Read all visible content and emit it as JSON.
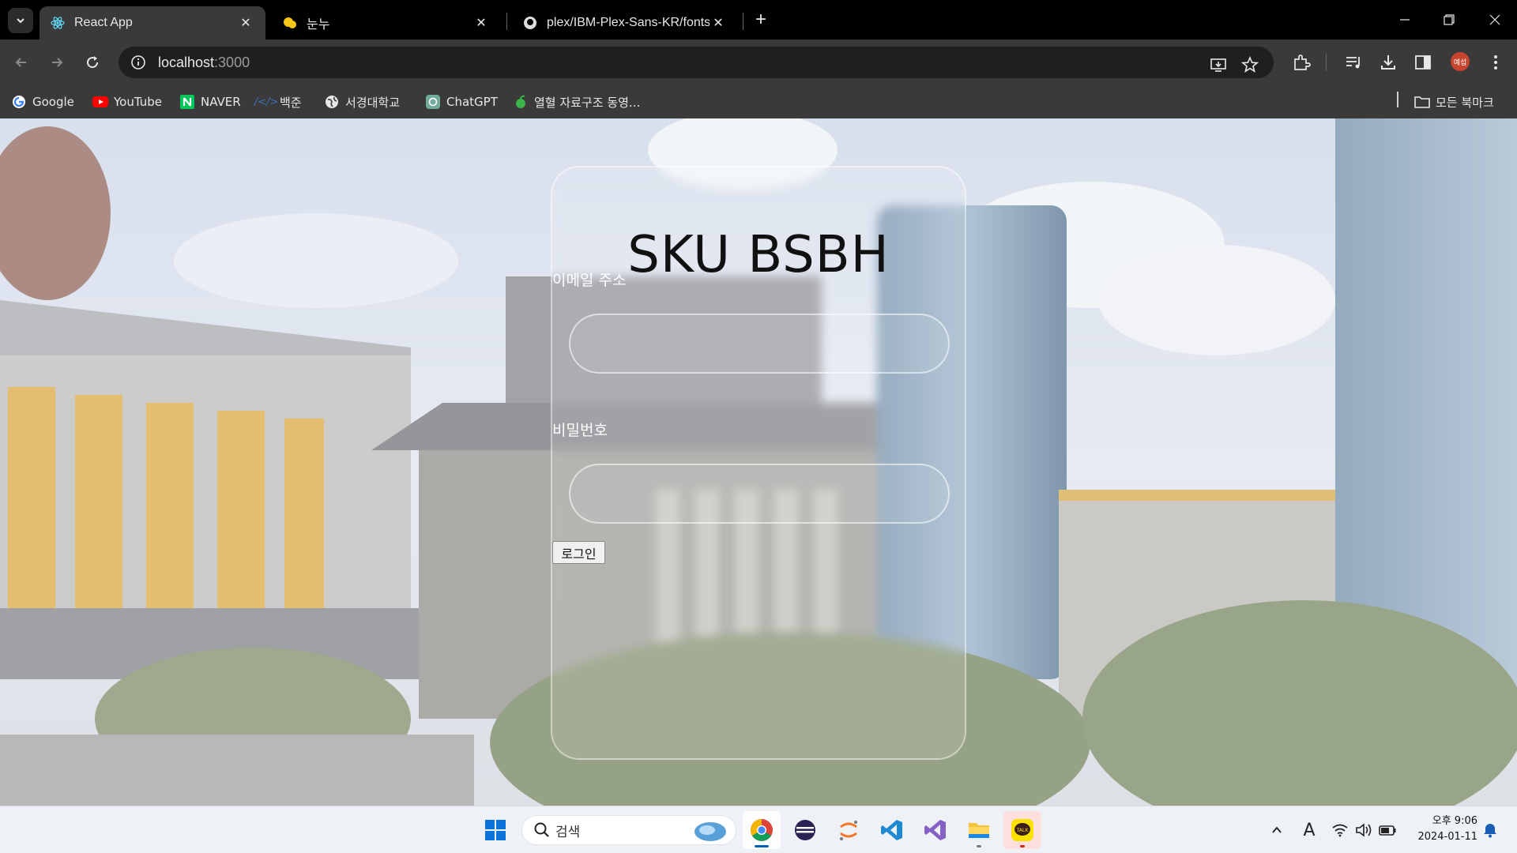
{
  "browser": {
    "tabs": [
      {
        "title": "React App",
        "favicon": "react-icon",
        "active": true
      },
      {
        "title": "눈누",
        "favicon": "noonnu-icon",
        "active": false
      },
      {
        "title": "plex/IBM-Plex-Sans-KR/fonts/c",
        "favicon": "github-icon",
        "active": false
      }
    ],
    "url_host": "localhost",
    "url_port": ":3000",
    "profile_label": "예섭",
    "bookmarks": [
      {
        "label": "Google",
        "icon": "google-icon"
      },
      {
        "label": "YouTube",
        "icon": "youtube-icon"
      },
      {
        "label": "NAVER",
        "icon": "naver-icon"
      },
      {
        "label": "백준",
        "icon": "baekjoon-icon"
      },
      {
        "label": "서경대학교",
        "icon": "globe-icon"
      },
      {
        "label": "ChatGPT",
        "icon": "chatgpt-icon"
      },
      {
        "label": "열혈 자료구조 동영...",
        "icon": "apple-icon"
      }
    ],
    "all_bookmarks_label": "모든 북마크"
  },
  "page": {
    "title": "SKU BSBH",
    "email_label": "이메일 주소",
    "email_value": "",
    "password_label": "비밀번호",
    "password_value": "",
    "login_button": "로그인"
  },
  "taskbar": {
    "search_label": "검색",
    "clock_time": "오후 9:06",
    "clock_date": "2024-01-11",
    "ime_indicator": "A"
  }
}
